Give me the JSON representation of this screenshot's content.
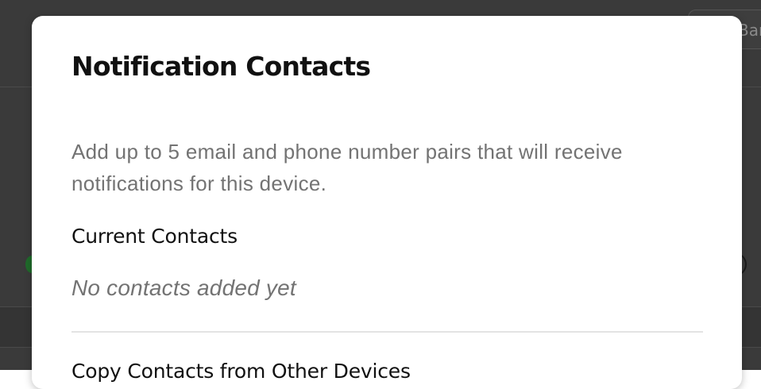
{
  "background": {
    "top_right_button_label": "Bar"
  },
  "modal": {
    "title": "Notification Contacts",
    "description": "Add up to 5 email and phone number pairs that will receive notifications for this device.",
    "current_contacts": {
      "heading": "Current Contacts",
      "empty_text": "No contacts added yet"
    },
    "copy_contacts": {
      "heading": "Copy Contacts from Other Devices"
    }
  }
}
